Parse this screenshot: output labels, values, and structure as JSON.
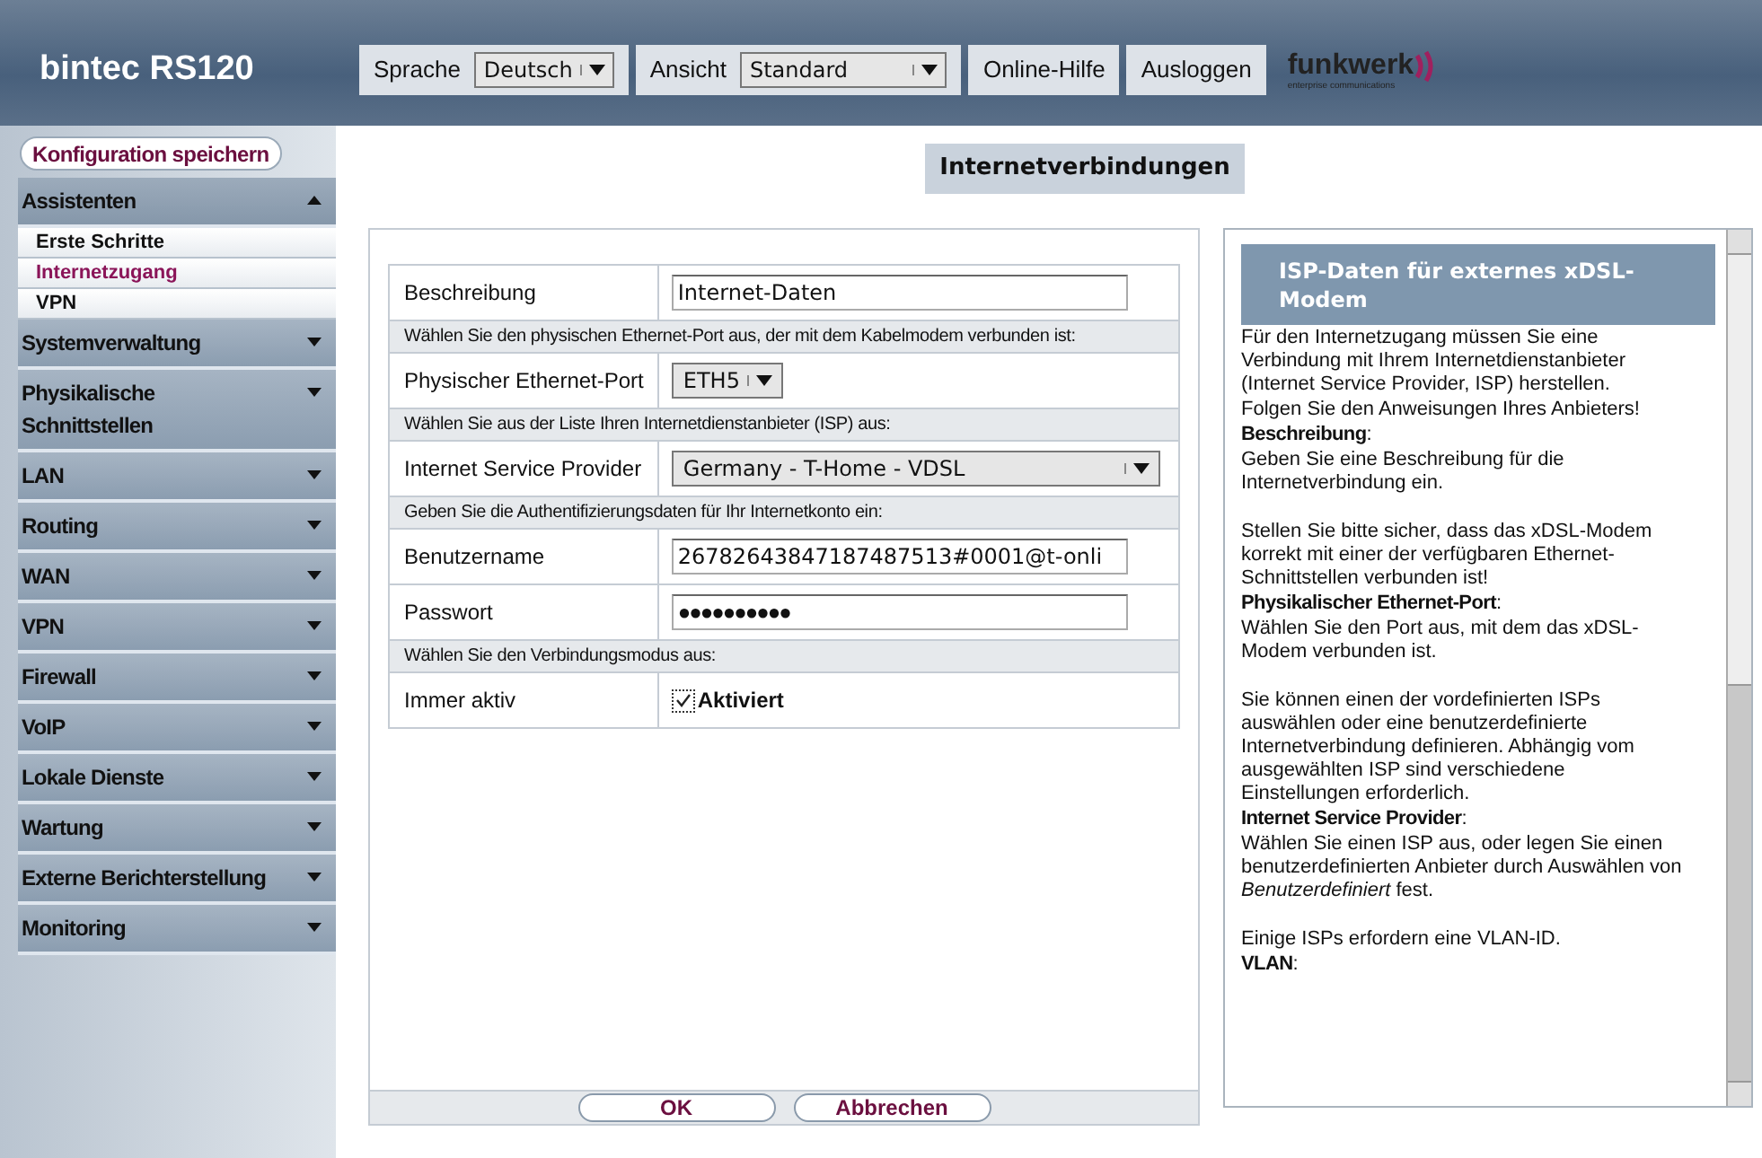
{
  "header": {
    "product": "bintec RS120",
    "language": {
      "label": "Sprache",
      "value": "Deutsch"
    },
    "view": {
      "label": "Ansicht",
      "value": "Standard"
    },
    "buttons": [
      "Online-Hilfe",
      "Ausloggen"
    ],
    "logo": {
      "name": "funkwerk",
      "tagline": "enterprise communications"
    }
  },
  "sidebar": {
    "save_button": "Konfiguration speichern",
    "items": [
      {
        "label": "Assistenten",
        "expanded": true,
        "children": [
          {
            "label": "Erste Schritte",
            "selected": false
          },
          {
            "label": "Internetzugang",
            "selected": true
          },
          {
            "label": "VPN",
            "selected": false
          }
        ]
      },
      {
        "label": "Systemverwaltung",
        "expanded": false
      },
      {
        "label": "Physikalische Schnittstellen",
        "expanded": false
      },
      {
        "label": "LAN",
        "expanded": false
      },
      {
        "label": "Routing",
        "expanded": false
      },
      {
        "label": "WAN",
        "expanded": false
      },
      {
        "label": "VPN",
        "expanded": false
      },
      {
        "label": "Firewall",
        "expanded": false
      },
      {
        "label": "VoIP",
        "expanded": false
      },
      {
        "label": "Lokale Dienste",
        "expanded": false
      },
      {
        "label": "Wartung",
        "expanded": false
      },
      {
        "label": "Externe Berichterstellung",
        "expanded": false
      },
      {
        "label": "Monitoring",
        "expanded": false
      }
    ]
  },
  "page_title": "Internetverbindungen",
  "form": {
    "rows": [
      {
        "kind": "text",
        "label": "Beschreibung",
        "value": "Internet-Daten"
      },
      {
        "kind": "hint",
        "text": "Wählen Sie den physischen Ethernet-Port aus, der mit dem Kabelmodem verbunden ist:"
      },
      {
        "kind": "select_small",
        "label": "Physischer Ethernet-Port",
        "value": "ETH5"
      },
      {
        "kind": "hint",
        "text": "Wählen Sie aus der Liste Ihren Internetdienstanbieter (ISP) aus:"
      },
      {
        "kind": "select_wide",
        "label": "Internet Service Provider",
        "value": "Germany - T-Home - VDSL"
      },
      {
        "kind": "hint",
        "text": "Geben Sie die Authentifizierungsdaten für Ihr Internetkonto ein:"
      },
      {
        "kind": "text",
        "label": "Benutzername",
        "value": "26782643847187487513#0001@t-onli"
      },
      {
        "kind": "password",
        "label": "Passwort",
        "value": "●●●●●●●●●●"
      },
      {
        "kind": "hint",
        "text": "Wählen Sie den Verbindungsmodus aus:"
      },
      {
        "kind": "checkbox",
        "label": "Immer aktiv",
        "option": "Aktiviert",
        "checked": true
      }
    ],
    "buttons": [
      "OK",
      "Abbrechen"
    ]
  },
  "help": {
    "title": "ISP-Daten für externes xDSL-Modem",
    "blocks": [
      {
        "kind": "text",
        "text": "Für den Internetzugang müssen Sie eine Verbindung mit Ihrem Internetdienstanbieter (Internet Service Provider, ISP) herstellen."
      },
      {
        "kind": "text",
        "text": "Folgen Sie den Anweisungen Ihres Anbieters!"
      },
      {
        "kind": "term",
        "text": "**Beschreibung**:"
      },
      {
        "kind": "text",
        "text": "Geben Sie eine Beschreibung für die Internetverbindung ein."
      },
      {
        "kind": "para",
        "text": "Stellen Sie bitte sicher, dass das xDSL-Modem korrekt mit einer der verfügbaren Ethernet-Schnittstellen verbunden ist!"
      },
      {
        "kind": "term",
        "text": "**Physikalischer Ethernet-Port**:"
      },
      {
        "kind": "text",
        "text": "Wählen Sie den Port aus, mit dem das xDSL-Modem verbunden ist."
      },
      {
        "kind": "para",
        "text": "Sie können einen der vordefinierten ISPs auswählen oder eine benutzerdefinierte Internetverbindung definieren. Abhängig vom ausgewählten ISP sind verschiedene Einstellungen erforderlich."
      },
      {
        "kind": "term",
        "text": "**Internet Service Provider**:"
      },
      {
        "kind": "text",
        "text": "Wählen Sie einen ISP aus, oder legen Sie einen benutzerdefinierten Anbieter durch Auswählen von *Benutzerdefiniert* fest."
      },
      {
        "kind": "para",
        "text": "Einige ISPs erfordern eine VLAN-ID."
      },
      {
        "kind": "term",
        "text": "**VLAN**:"
      }
    ]
  }
}
